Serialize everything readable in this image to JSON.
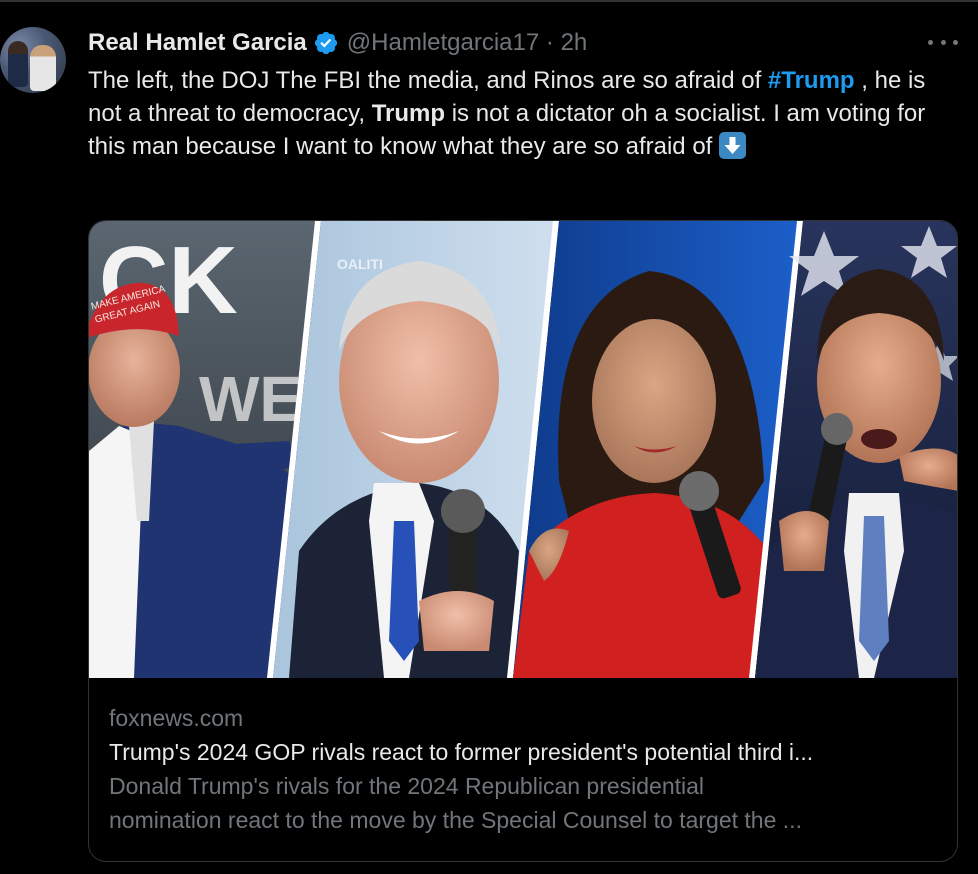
{
  "tweet": {
    "author": {
      "display_name": "Real Hamlet Garcia",
      "handle": "@Hamletgarcia17",
      "separator": "·",
      "time": "2h",
      "verified": true,
      "verified_color": "#1d9bf0"
    },
    "text": {
      "part1": "The left, the DOJ The FBI the media, and Rinos are so afraid of ",
      "hashtag": "#Trump",
      "part2": " , he is not a threat to democracy, ",
      "bold": "Trump",
      "part3": " is not a dictator oh a socialist. I am voting for this man because I want to know what they are so afraid of ",
      "emoji": "down-arrow-emoji"
    },
    "more_icon": "more-horizontal-icon",
    "link_color": "#1d9bf0"
  },
  "card": {
    "domain": "foxnews.com",
    "title": "Trump's 2024 GOP rivals react to former president's potential third i...",
    "description_line1": "Donald Trump's rivals for the 2024 Republican presidential",
    "description_line2": "nomination react to the move by the Special Counsel to target the ...",
    "image": {
      "panels": [
        "trump-photo",
        "hutchinson-photo",
        "haley-photo",
        "desantis-photo"
      ],
      "sign_text_ck": "CK",
      "sign_text_we": "WE",
      "hat_text_line1": "MAKE AMERICA",
      "hat_text_line2": "GREAT AGAIN"
    }
  },
  "colors": {
    "background": "#000000",
    "text_primary": "#e7e9ea",
    "text_secondary": "#71767b",
    "border": "#2f3336"
  }
}
